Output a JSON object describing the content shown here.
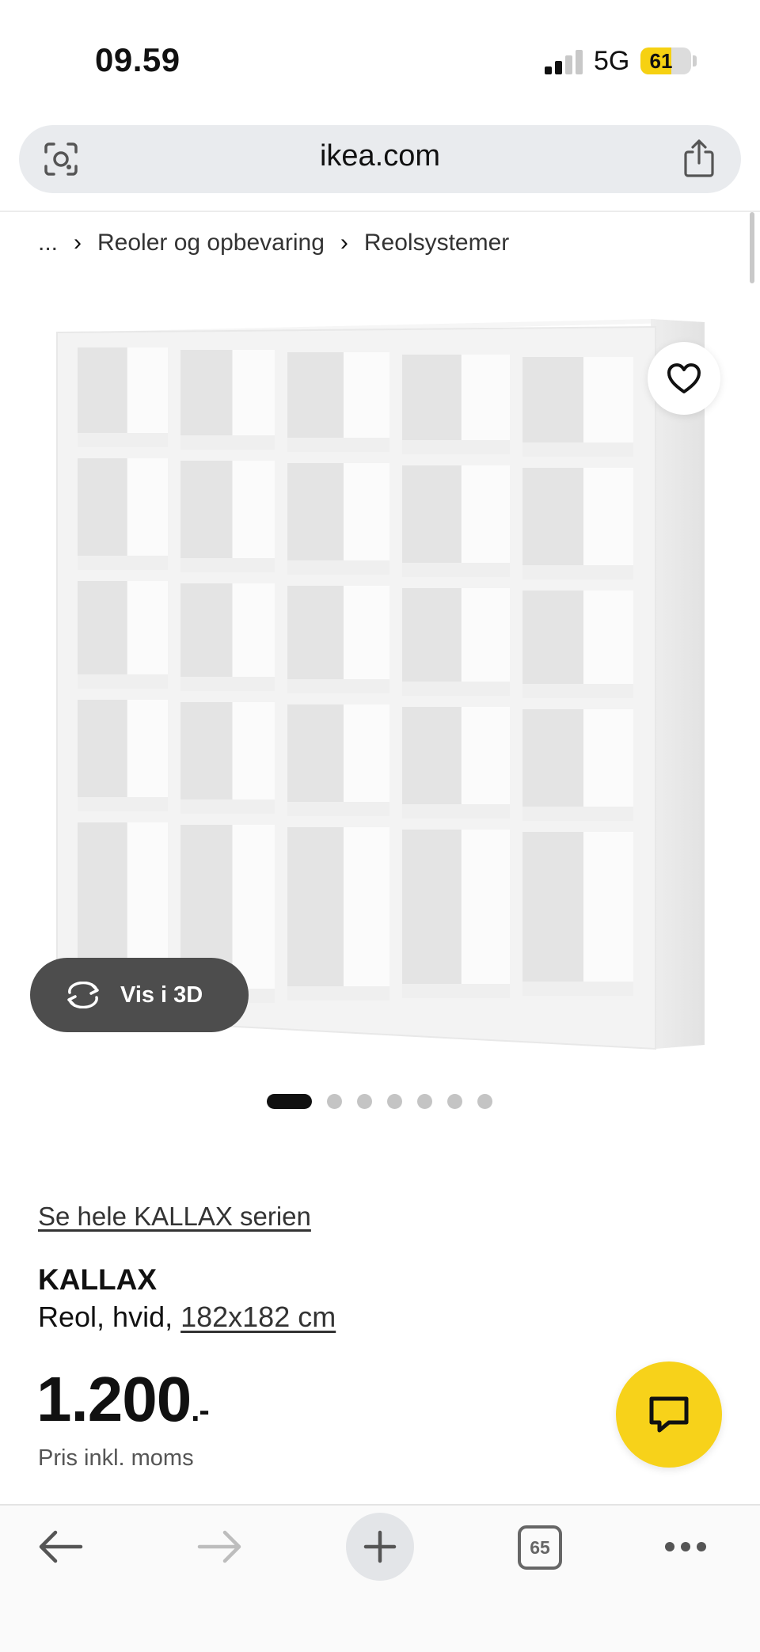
{
  "status_bar": {
    "time": "09.59",
    "network": "5G",
    "battery": "61",
    "battery_level": 0.61
  },
  "browser": {
    "url": "ikea.com",
    "open_tabs": "65"
  },
  "breadcrumb": {
    "ellipsis": "...",
    "items": [
      "Reoler og opbevaring",
      "Reolsystemer"
    ],
    "separator": "›"
  },
  "gallery": {
    "view_3d_label": "Vis i 3D",
    "image_count": 7,
    "active_index": 0
  },
  "product": {
    "series_link": "Se hele KALLAX serien",
    "name": "KALLAX",
    "description_prefix": "Reol, hvid, ",
    "size": "182x182 cm",
    "price": "1.200",
    "price_suffix": ".-",
    "price_note": "Pris inkl. moms"
  },
  "colors": {
    "accent_yellow": "#f7d21a",
    "dark_pill": "#4d4d4d"
  },
  "icons": [
    "lens-icon",
    "share-icon",
    "heart-icon",
    "rotate-3d-icon",
    "chat-icon",
    "back-arrow-icon",
    "forward-arrow-icon",
    "plus-icon",
    "tabs-icon",
    "more-icon"
  ]
}
